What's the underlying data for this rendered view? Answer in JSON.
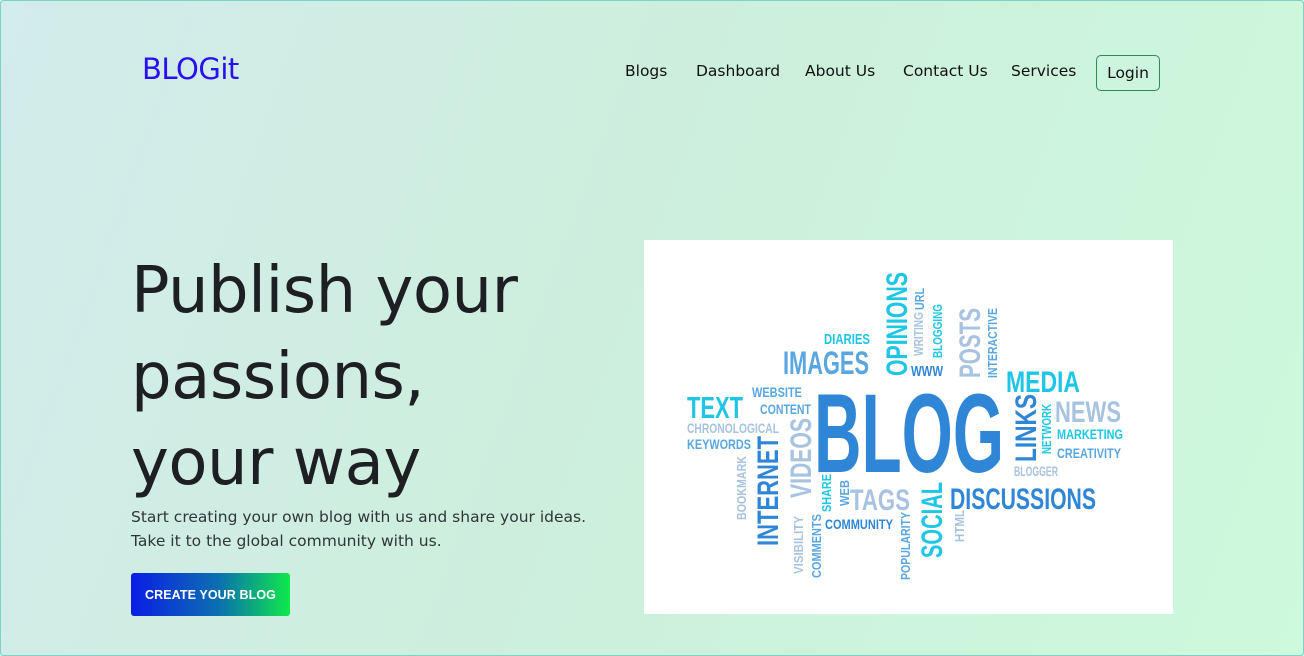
{
  "brand": {
    "name": "BLOGit"
  },
  "nav": {
    "items": [
      {
        "label": "Blogs"
      },
      {
        "label": "Dashboard"
      },
      {
        "label": "About Us"
      },
      {
        "label": "Contact Us"
      },
      {
        "label": "Services"
      }
    ],
    "login_label": "Login"
  },
  "hero": {
    "title_lines": [
      "Publish your",
      "passions,",
      "your way"
    ],
    "subtitle_lines": [
      "Start creating your own blog with us and share your ideas.",
      "Take it to the global community with us."
    ],
    "cta_label": "CREATE YOUR BLOG"
  },
  "word_cloud": {
    "words": {
      "blog": "BLOG",
      "images": "IMAGES",
      "opinions": "OPINIONS",
      "diaries": "DIARIES",
      "writing": "WRITING",
      "url": "URL",
      "blogging": "BLOGGING",
      "www": "WWW",
      "posts": "POSTS",
      "interactive": "INTERACTIVE",
      "media": "MEDIA",
      "text": "TEXT",
      "website": "WEBSITE",
      "content": "CONTENT",
      "chronological": "CHRONOLOGICAL",
      "keywords": "KEYWORDS",
      "news": "NEWS",
      "links": "LINKS",
      "network": "NETWORK",
      "marketing": "MARKETING",
      "creativity": "CREATIVITY",
      "blogger": "BLOGGER",
      "bookmark": "BOOKMARK",
      "internet": "INTERNET",
      "videos": "VIDEOS",
      "share": "SHARE",
      "web": "WEB",
      "tags": "TAGS",
      "discussions": "DISCUSSIONS",
      "visibility": "VISIBILITY",
      "comments": "COMMENTS",
      "community": "COMMUNITY",
      "popularity": "POPULARITY",
      "social": "SOCIAL",
      "html": "HTML"
    },
    "colors": {
      "dark": "#2f86d6",
      "cyan": "#1ec6e6",
      "light": "#a8c3df",
      "mid": "#5aa6e0"
    }
  }
}
